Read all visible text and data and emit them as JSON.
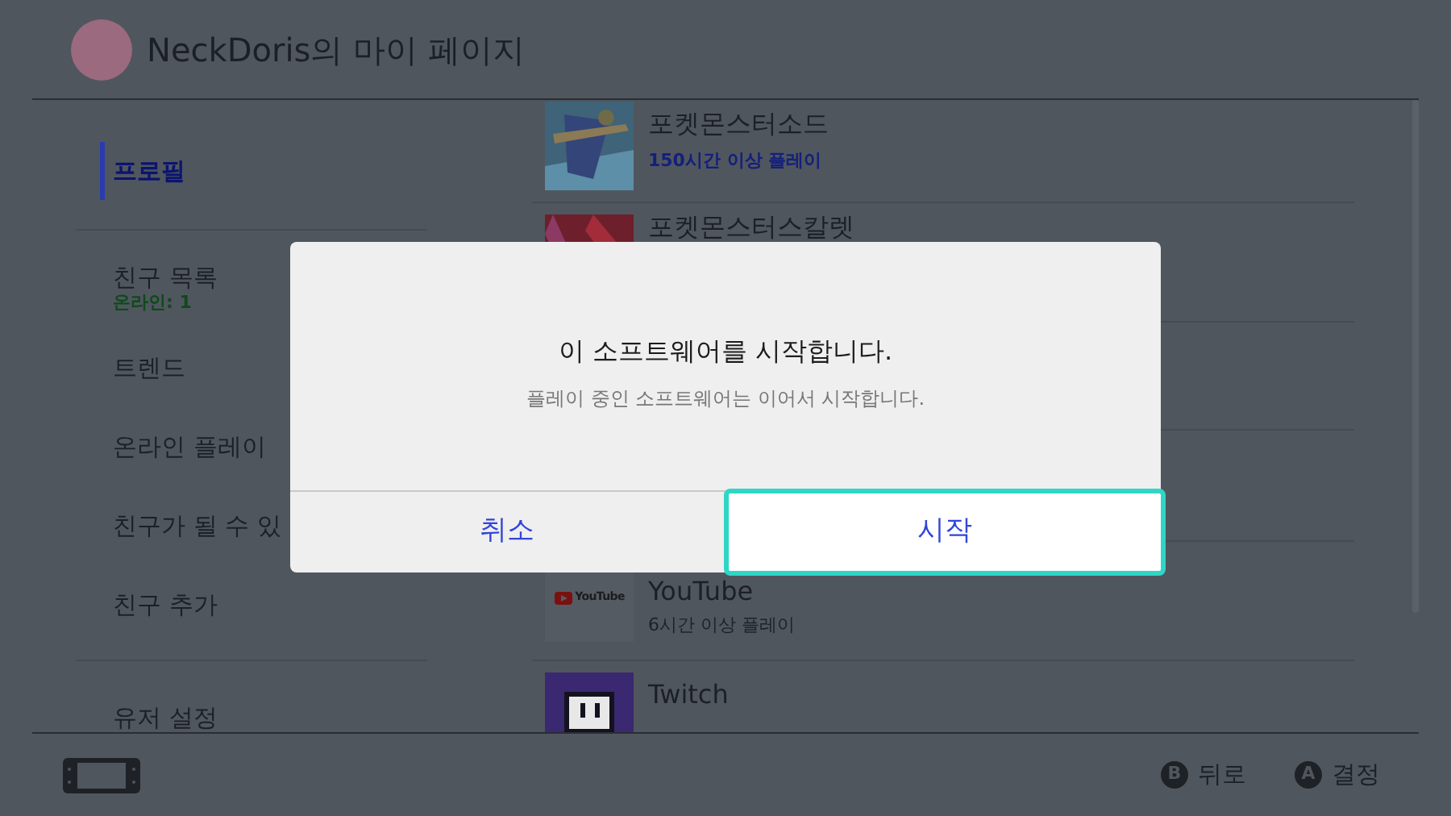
{
  "header": {
    "title": "NeckDoris의 마이 페이지"
  },
  "sidebar": {
    "items": [
      {
        "label": "프로필",
        "selected": true,
        "divider_after": true
      },
      {
        "label": "친구 목록",
        "sub": "온라인: 1",
        "selected": false
      },
      {
        "label": "트렌드",
        "selected": false
      },
      {
        "label": "온라인 플레이",
        "selected": false
      },
      {
        "label": "친구가 될 수 있",
        "selected": false
      },
      {
        "label": "친구 추가",
        "selected": false,
        "divider_after": true
      },
      {
        "label": "유저 설정",
        "selected": false
      }
    ]
  },
  "software": [
    {
      "kind": "picture",
      "title": "포켓몬스터소드",
      "playtime": "150시간 이상 플레이",
      "highlighted": true
    },
    {
      "kind": "picture",
      "title": "포켓몬스터스칼렛"
    },
    {
      "kind": "hidden"
    },
    {
      "kind": "hidden"
    },
    {
      "kind": "youtube",
      "logo_text": "YouTube",
      "title": "YouTube",
      "playtime": "6시간 이상 플레이",
      "highlighted": false
    },
    {
      "kind": "twitch",
      "title": "Twitch"
    }
  ],
  "dialog": {
    "title": "이 소프트웨어를 시작합니다.",
    "message": "플레이 중인 소프트웨어는 이어서 시작합니다.",
    "buttons": [
      {
        "label": "취소",
        "selected": false
      },
      {
        "label": "시작",
        "selected": true
      }
    ]
  },
  "footer": {
    "hints": [
      {
        "key": "B",
        "label": "뒤로"
      },
      {
        "key": "A",
        "label": "결정"
      }
    ]
  }
}
